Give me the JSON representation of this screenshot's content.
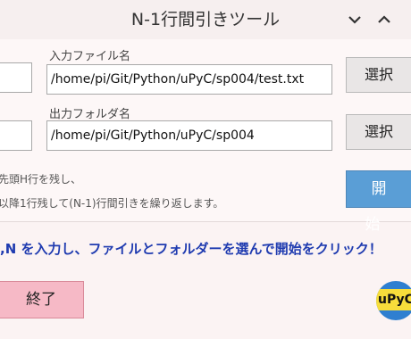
{
  "window": {
    "title": "N-1行間引きツール",
    "minimize_icon": "chevron-down-icon",
    "maximize_icon": "chevron-up-icon"
  },
  "input": {
    "h_value": "",
    "label": "入力ファイル名",
    "path": "/home/pi/Git/Python/uPyC/sp004/test.txt",
    "select_label": "選択"
  },
  "output": {
    "n_value": "",
    "label": "出力フォルダ名",
    "path": "/home/pi/Git/Python/uPyC/sp004",
    "select_label": "選択"
  },
  "notes": {
    "line1": "先頭H行を残し、",
    "line2": "以降1行残して(N-1)行間引きを繰り返します。"
  },
  "start_label": "開始",
  "message": ",N を入力し、ファイルとフォルダーを選んで開始をクリック！",
  "quit_label": "終了",
  "logo": "uPyC",
  "colors": {
    "accent_blue": "#5a9ed6",
    "quit_pink": "#f6b9c6",
    "message_blue": "#1f3bb0"
  }
}
